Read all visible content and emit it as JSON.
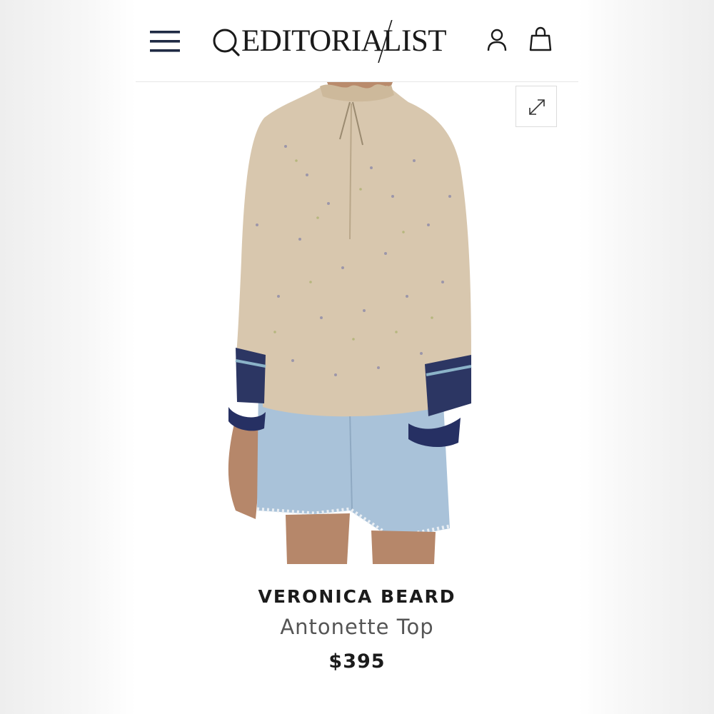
{
  "header": {
    "logo_text": "EDITORIALIST",
    "icons": {
      "menu": "hamburger-menu-icon",
      "search": "search-icon",
      "account": "account-icon",
      "bag": "shopping-bag-icon"
    }
  },
  "gallery": {
    "expand_icon": "expand-icon"
  },
  "product": {
    "brand": "VERONICA BEARD",
    "name": "Antonette Top",
    "price": "$395"
  },
  "colors": {
    "text_dark": "#1b1b1b",
    "text_muted": "#555555",
    "icon_blue": "#1f2a44"
  }
}
